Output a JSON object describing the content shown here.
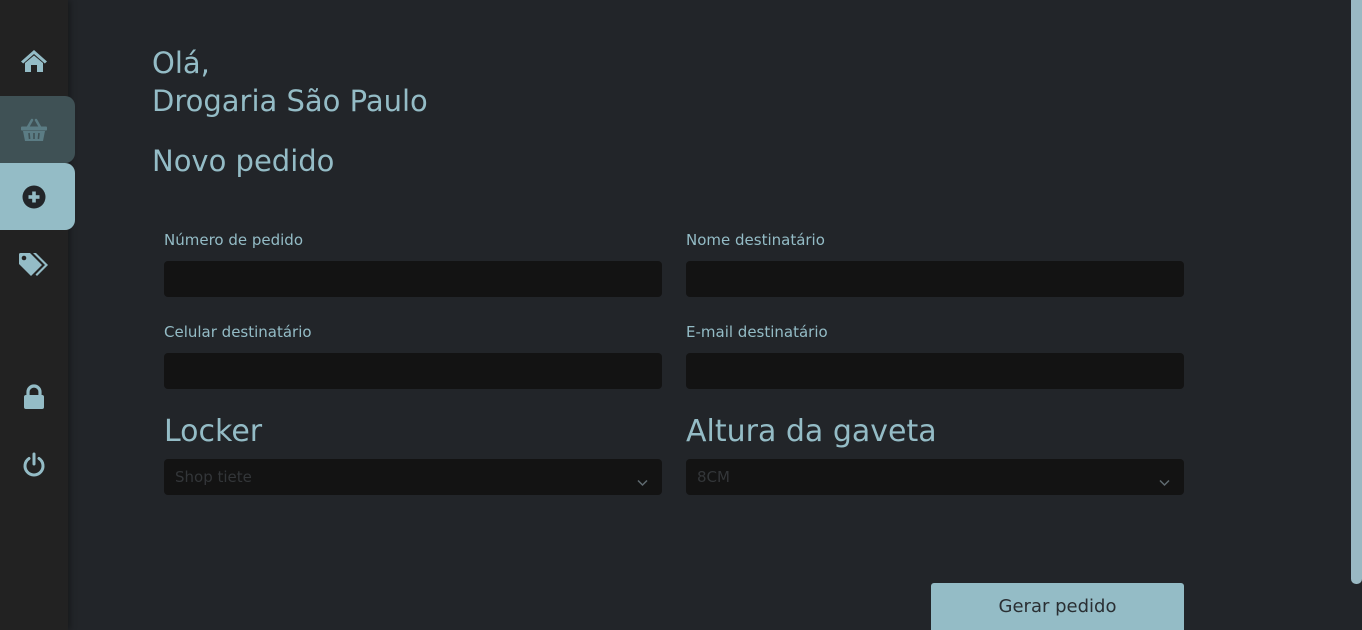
{
  "colors": {
    "accent": "#94bcc6",
    "background": "#222529",
    "sidebar": "#222222",
    "input_bg": "#131313",
    "active_nav_icon": "#222529"
  },
  "sidebar": {
    "items": [
      {
        "icon": "home-icon",
        "state": "normal"
      },
      {
        "icon": "basket-icon",
        "state": "hovered"
      },
      {
        "icon": "plus-circle-icon",
        "state": "active"
      },
      {
        "icon": "tags-icon",
        "state": "normal"
      },
      {
        "icon": "lock-icon",
        "state": "normal"
      },
      {
        "icon": "power-icon",
        "state": "normal"
      }
    ]
  },
  "header": {
    "greeting_line1": "Olá,",
    "greeting_line2": "Drogaria São Paulo",
    "title": "Novo pedido"
  },
  "form": {
    "order_number": {
      "label": "Número de pedido",
      "value": ""
    },
    "recipient_name": {
      "label": "Nome destinatário",
      "value": ""
    },
    "recipient_phone": {
      "label": "Celular destinatário",
      "value": ""
    },
    "recipient_email": {
      "label": "E-mail destinatário",
      "value": ""
    },
    "locker": {
      "label": "Locker",
      "value": "Shop tiete"
    },
    "drawer_height": {
      "label": "Altura da gaveta",
      "value": "8CM"
    },
    "submit_label": "Gerar pedido"
  }
}
